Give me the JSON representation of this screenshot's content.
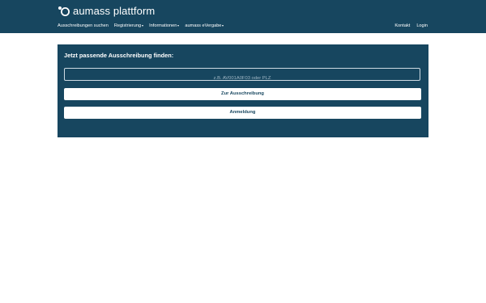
{
  "brand": {
    "name": "aumass plattform",
    "logo_icon": "aumass-logo-icon"
  },
  "nav": {
    "left": [
      {
        "label": "Ausschreibungen suchen",
        "dropdown": false
      },
      {
        "label": "Registrierung",
        "dropdown": true
      },
      {
        "label": "Informationen",
        "dropdown": true
      },
      {
        "label": "aumass eVergabe",
        "dropdown": true
      }
    ],
    "right": [
      {
        "label": "Kontakt"
      },
      {
        "label": "Login"
      }
    ]
  },
  "panel": {
    "title": "Jetzt passende Ausschreibung finden:",
    "search_placeholder": "z.B. AV001A0F03 oder PLZ",
    "search_value": "",
    "primary_button": "Zur Ausschreibung",
    "secondary_button": "Anmeldung"
  },
  "colors": {
    "brand_dark": "#17465f",
    "text_light": "#ffffff",
    "button_bg": "#ffffff"
  }
}
